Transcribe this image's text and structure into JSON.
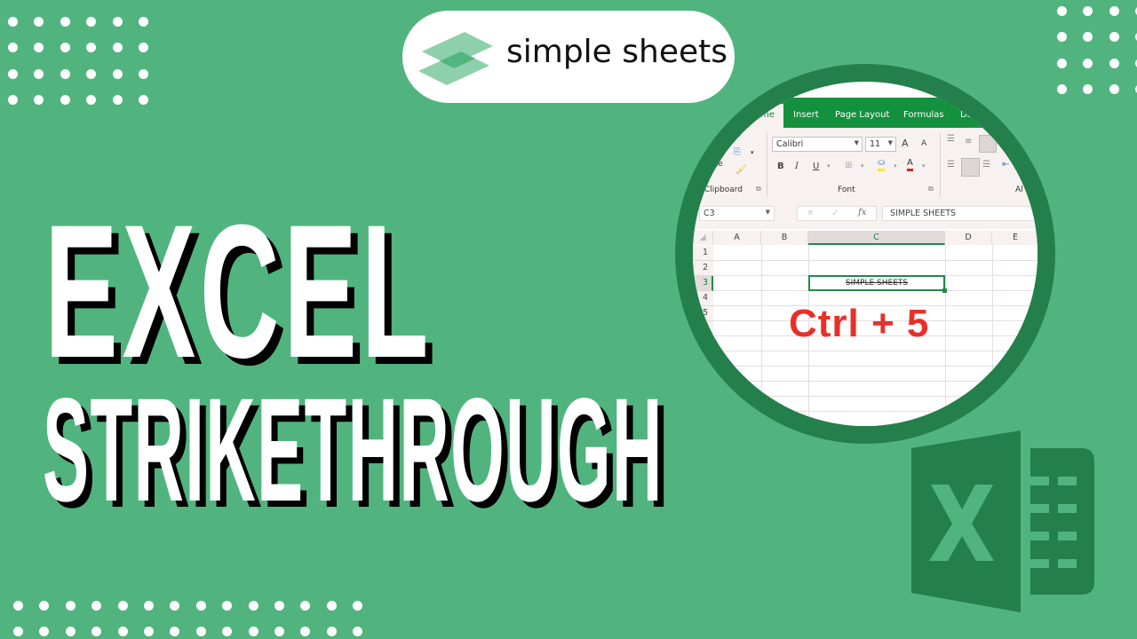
{
  "brand": {
    "logo_text": "simple sheets",
    "logo_icon": "stacked-sheets-icon",
    "colors": {
      "background": "#51b47e",
      "ring": "#23804a",
      "ribbon_green": "#14913e",
      "shortcut_red": "#e8302a",
      "logo_light": "#8fd0ac",
      "logo_dark": "#53b57e"
    }
  },
  "headline": {
    "line1": "EXCEL",
    "line2": "STRIKETHROUGH"
  },
  "excel_preview": {
    "tabs": [
      {
        "label": "Home",
        "partial": "me",
        "active": true
      },
      {
        "label": "Insert"
      },
      {
        "label": "Page Layout"
      },
      {
        "label": "Formulas"
      },
      {
        "label": "Da"
      }
    ],
    "ribbon": {
      "groups": [
        "Clipboard",
        "Font",
        "Al"
      ],
      "paste_label_partial": "ste",
      "font_name": "Calibri",
      "font_size": "11",
      "bold": "B",
      "italic": "I",
      "underline": "U",
      "grow_font": "A",
      "shrink_font": "A",
      "font_color": "A"
    },
    "name_box": "C3",
    "formula_bar": "SIMPLE SHEETS",
    "fx_label": "fx",
    "columns": [
      "A",
      "B",
      "C",
      "D",
      "E"
    ],
    "rows": [
      "1",
      "2",
      "3",
      "4",
      "5"
    ],
    "active_cell_text": "SIMPLE SHEETS",
    "shortcut": "Ctrl + 5"
  },
  "decorations": {
    "excel_logo_icon": "excel-logo-icon",
    "dot_grids": [
      "top-left",
      "top-right",
      "bottom-left"
    ]
  }
}
